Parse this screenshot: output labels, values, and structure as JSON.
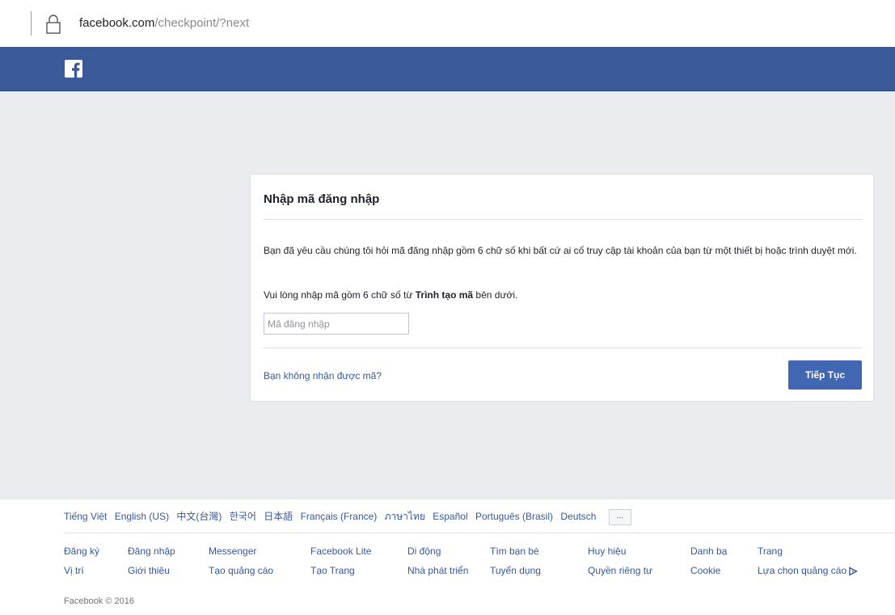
{
  "browser": {
    "url_domain": "facebook.com",
    "url_path": "/checkpoint/?next"
  },
  "card": {
    "title": "Nhập mã đăng nhập",
    "paragraph1": "Bạn đã yêu cầu chúng tôi hỏi mã đăng nhập gồm 6 chữ số khi bất cứ ai cố truy cập tài khoản của bạn từ một thiết bị hoặc trình duyệt mới.",
    "paragraph2_before": "Vui lòng nhập mã gồm 6 chữ số từ ",
    "paragraph2_bold": "Trình tạo mã",
    "paragraph2_after": " bên dưới.",
    "input_placeholder": "Mã đăng nhập",
    "input_value": "",
    "no_code_link": "Bạn không nhận được mã?",
    "continue_button": "Tiếp Tục"
  },
  "footer": {
    "languages": [
      "Tiếng Việt",
      "English (US)",
      "中文(台灣)",
      "한국어",
      "日本語",
      "Français (France)",
      "ภาษาไทย",
      "Español",
      "Português (Brasil)",
      "Deutsch"
    ],
    "more_languages": "...",
    "links_row1": [
      "Đăng ký",
      "Đăng nhập",
      "Messenger",
      "Facebook Lite",
      "Di động",
      "Tìm bạn bè",
      "Huy hiệu",
      "Danh bạ",
      "Trang"
    ],
    "links_row2": [
      "Vị trí",
      "Giới thiệu",
      "Tạo quảng cáo",
      "Tạo Trang",
      "Nhà phát triển",
      "Tuyển dụng",
      "Quyền riêng tư",
      "Cookie",
      "Lựa chọn quảng cáo"
    ],
    "copyright": "Facebook © 2016"
  },
  "colors": {
    "header_blue": "#3b5998",
    "button_blue": "#4267b2",
    "link_blue": "#365899",
    "background_gray": "#e9ebee"
  },
  "icons": [
    "lock-icon",
    "facebook-logo-icon",
    "ad-choices-icon"
  ]
}
